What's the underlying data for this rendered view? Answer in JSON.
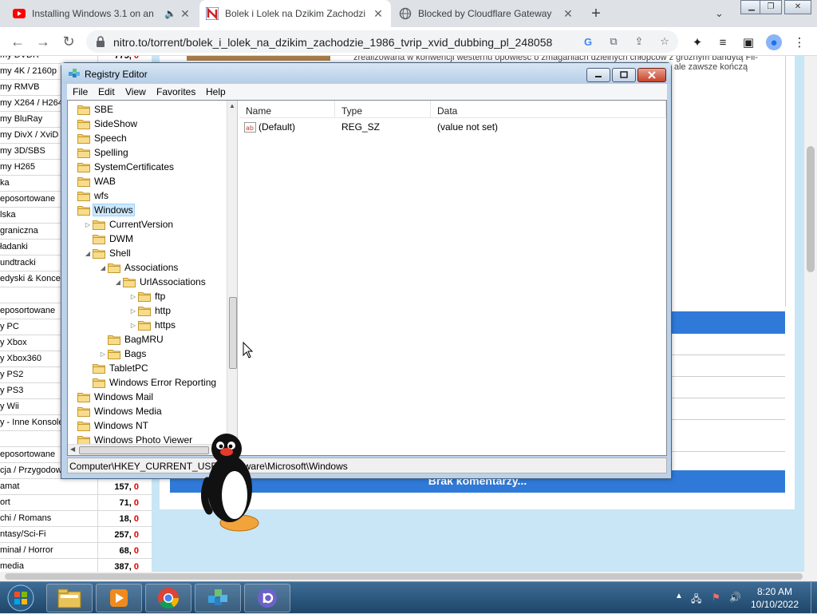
{
  "browser": {
    "tabs": [
      {
        "title": "Installing Windows 3.1 on an",
        "favicon": "youtube-icon",
        "active": false
      },
      {
        "title": "Bolek i Lolek na Dzikim Zachodzi",
        "favicon": "nitro-icon",
        "active": true
      },
      {
        "title": "Blocked by Cloudflare Gateway",
        "favicon": "globe-icon",
        "active": false
      }
    ],
    "new_tab": "+",
    "url": "nitro.to/torrent/bolek_i_lolek_na_dzikim_zachodzie_1986_tvrip_xvid_dubbing_pl_248058",
    "window_buttons": [
      "minimize",
      "restore",
      "close"
    ]
  },
  "webpage": {
    "description_line1": "zrealizowana w konwencji westernu opowieść o zmaganiach dzielnych chłopców z groźnym bandytą Fil-",
    "description_line2": "zne, ale zawsze kończą",
    "comments_button": "Brak komentarzy...",
    "categories": [
      {
        "name": "my DVDR",
        "count": "775,",
        "zero": "0"
      },
      {
        "name": "my 4K / 2160p",
        "count": "",
        "zero": ""
      },
      {
        "name": "my RMVB",
        "count": "",
        "zero": ""
      },
      {
        "name": "my X264 / H264",
        "count": "",
        "zero": ""
      },
      {
        "name": "my BluRay",
        "count": "",
        "zero": ""
      },
      {
        "name": "my DivX / XviD",
        "count": "",
        "zero": ""
      },
      {
        "name": "my 3D/SBS",
        "count": "",
        "zero": ""
      },
      {
        "name": "my H265",
        "count": "",
        "zero": ""
      },
      {
        "name": "ka",
        "count": "",
        "zero": ""
      },
      {
        "name": "eposortowane",
        "count": "",
        "zero": ""
      },
      {
        "name": "lska",
        "count": "",
        "zero": ""
      },
      {
        "name": "graniczna",
        "count": "",
        "zero": ""
      },
      {
        "name": "ładanki",
        "count": "",
        "zero": ""
      },
      {
        "name": "undtracki",
        "count": "",
        "zero": ""
      },
      {
        "name": "edyski & Koncer",
        "count": "",
        "zero": ""
      },
      {
        "name": "",
        "count": "",
        "zero": ""
      },
      {
        "name": "eposortowane",
        "count": "",
        "zero": ""
      },
      {
        "name": "y PC",
        "count": "",
        "zero": ""
      },
      {
        "name": "y Xbox",
        "count": "",
        "zero": ""
      },
      {
        "name": "y Xbox360",
        "count": "",
        "zero": ""
      },
      {
        "name": "y PS2",
        "count": "",
        "zero": ""
      },
      {
        "name": "y PS3",
        "count": "",
        "zero": ""
      },
      {
        "name": "y Wii",
        "count": "",
        "zero": ""
      },
      {
        "name": "y - Inne Konsole",
        "count": "",
        "zero": ""
      },
      {
        "name": "",
        "count": "",
        "zero": ""
      },
      {
        "name": "eposortowane",
        "count": "",
        "zero": ""
      },
      {
        "name": "cja / Przygodow",
        "count": "",
        "zero": ""
      },
      {
        "name": "amat",
        "count": "157,",
        "zero": "0"
      },
      {
        "name": "ort",
        "count": "71,",
        "zero": "0"
      },
      {
        "name": "chi / Romans",
        "count": "18,",
        "zero": "0"
      },
      {
        "name": "ntasy/Sci-Fi",
        "count": "257,",
        "zero": "0"
      },
      {
        "name": "minał / Horror",
        "count": "68,",
        "zero": "0"
      },
      {
        "name": "media",
        "count": "387,",
        "zero": "0"
      }
    ]
  },
  "regedit": {
    "title": "Registry Editor",
    "menu": [
      "File",
      "Edit",
      "View",
      "Favorites",
      "Help"
    ],
    "tree": [
      {
        "label": "SBE",
        "arrow": "",
        "indent": 0
      },
      {
        "label": "SideShow",
        "arrow": "",
        "indent": 0
      },
      {
        "label": "Speech",
        "arrow": "",
        "indent": 0
      },
      {
        "label": "Spelling",
        "arrow": "",
        "indent": 0
      },
      {
        "label": "SystemCertificates",
        "arrow": "",
        "indent": 0
      },
      {
        "label": "WAB",
        "arrow": "",
        "indent": 0
      },
      {
        "label": "wfs",
        "arrow": "",
        "indent": 0
      },
      {
        "label": "Windows",
        "arrow": "",
        "indent": 0,
        "selected": true
      },
      {
        "label": "CurrentVersion",
        "arrow": "▷",
        "indent": 1
      },
      {
        "label": "DWM",
        "arrow": "",
        "indent": 1
      },
      {
        "label": "Shell",
        "arrow": "◢",
        "indent": 1
      },
      {
        "label": "Associations",
        "arrow": "◢",
        "indent": 2
      },
      {
        "label": "UrlAssociations",
        "arrow": "◢",
        "indent": 3
      },
      {
        "label": "ftp",
        "arrow": "▷",
        "indent": 4
      },
      {
        "label": "http",
        "arrow": "▷",
        "indent": 4
      },
      {
        "label": "https",
        "arrow": "▷",
        "indent": 4
      },
      {
        "label": "BagMRU",
        "arrow": "",
        "indent": 2
      },
      {
        "label": "Bags",
        "arrow": "▷",
        "indent": 2
      },
      {
        "label": "TabletPC",
        "arrow": "",
        "indent": 1
      },
      {
        "label": "Windows Error Reporting",
        "arrow": "",
        "indent": 1
      },
      {
        "label": "Windows Mail",
        "arrow": "",
        "indent": 0
      },
      {
        "label": "Windows Media",
        "arrow": "",
        "indent": 0
      },
      {
        "label": "Windows NT",
        "arrow": "",
        "indent": 0
      },
      {
        "label": "Windows Photo Viewer",
        "arrow": "",
        "indent": 0
      }
    ],
    "columns": [
      "Name",
      "Type",
      "Data"
    ],
    "values": [
      {
        "name": "(Default)",
        "type": "REG_SZ",
        "data": "(value not set)",
        "icon": "string-value-icon"
      }
    ],
    "status_path": "Computer\\HKEY_CURRENT_USER\\Software\\Microsoft\\Windows"
  },
  "taskbar": {
    "apps": [
      "explorer-icon",
      "media-player-icon",
      "chrome-icon",
      "registry-editor-icon",
      "bittorrent-icon"
    ],
    "time": "8:20 AM",
    "date": "10/10/2022"
  },
  "colors": {
    "accent_blue": "#2f7ad8",
    "selection": "#cce8ff",
    "count_zero": "#dd0000",
    "taskbar": "#1d4669"
  }
}
